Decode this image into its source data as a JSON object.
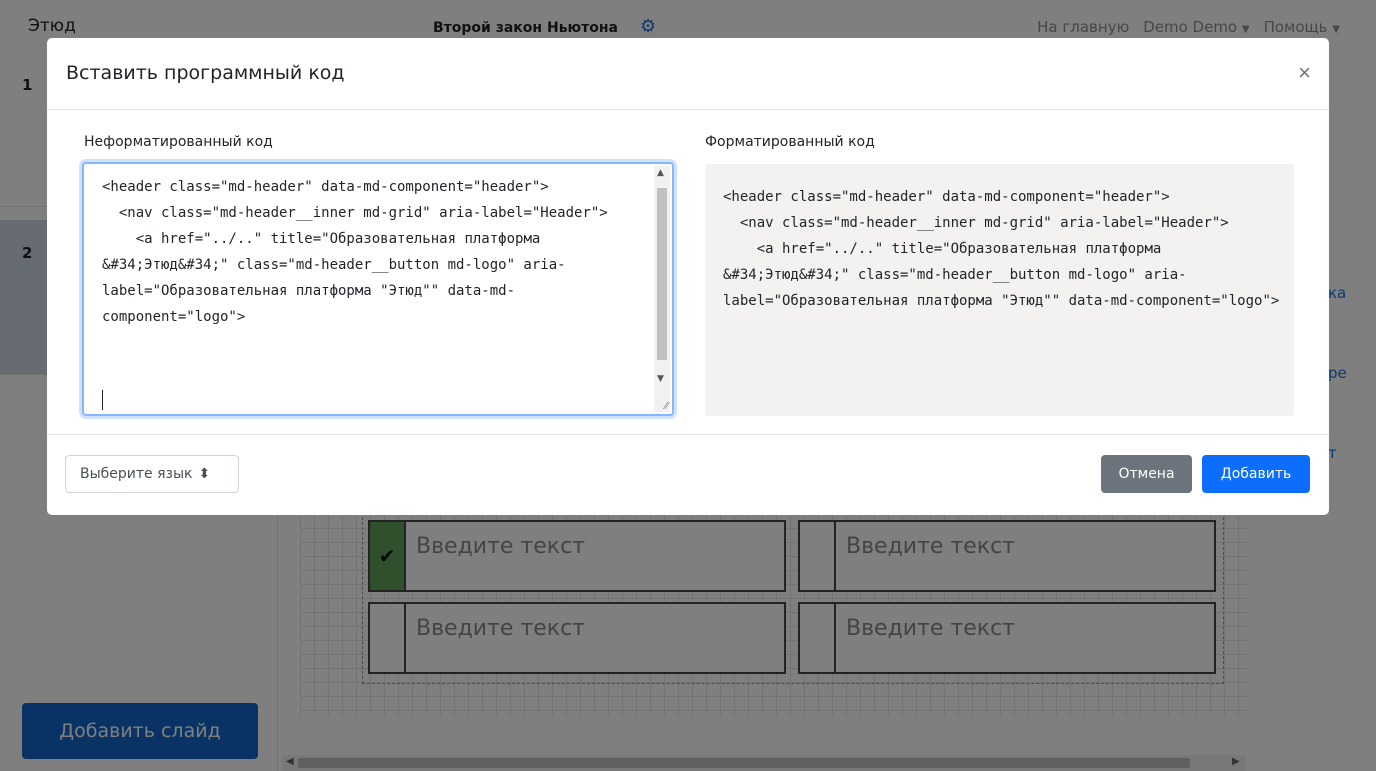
{
  "navbar": {
    "brand": "Этюд",
    "document_title": "Второй закон Ньютона",
    "links": [
      "На главную",
      "Demo Demo",
      "Помощь"
    ]
  },
  "sidebar": {
    "slides": [
      {
        "number": "1"
      },
      {
        "number": "2"
      }
    ],
    "add_slide_label": "Добавить слайд"
  },
  "canvas": {
    "answers": [
      {
        "text": "Введите текст",
        "checked": true
      },
      {
        "text": "Введите текст",
        "checked": false
      },
      {
        "text": "Введите текст",
        "checked": false
      },
      {
        "text": "Введите текст",
        "checked": false
      }
    ],
    "right_edge_fragments": [
      "ка",
      "ре",
      "т"
    ]
  },
  "modal": {
    "title": "Вставить программный код",
    "close_label": "×",
    "raw_label": "Неформатированный код",
    "formatted_label": "Форматированный код",
    "raw_code": "<header class=\"md-header\" data-md-component=\"header\">\n  <nav class=\"md-header__inner md-grid\" aria-label=\"Header\">\n    <a href=\"../..\" title=\"Образовательная платформа &#34;Этюд&#34;\" class=\"md-header__button md-logo\" aria-label=\"Образовательная платформа \"Этюд\"\" data-md-component=\"logo\">",
    "formatted_code": "<header class=\"md-header\" data-md-component=\"header\">\n  <nav class=\"md-header__inner md-grid\" aria-label=\"Header\">\n    <a href=\"../..\" title=\"Образовательная платформа &#34;Этюд&#34;\" class=\"md-header__button md-logo\" aria-label=\"Образовательная платформа \"Этюд\"\" data-md-component=\"logo\">",
    "language_select": "Выберите язык",
    "cancel_label": "Отмена",
    "add_label": "Добавить"
  },
  "colors": {
    "primary": "#0d6efd",
    "secondary": "#6c757d",
    "checked_green": "#5f9e5b",
    "active_slide": "#cdd9e3"
  },
  "icons": [
    "gear-icon",
    "caret-down-icon",
    "close-icon",
    "checkmark-icon",
    "sort-icon"
  ]
}
